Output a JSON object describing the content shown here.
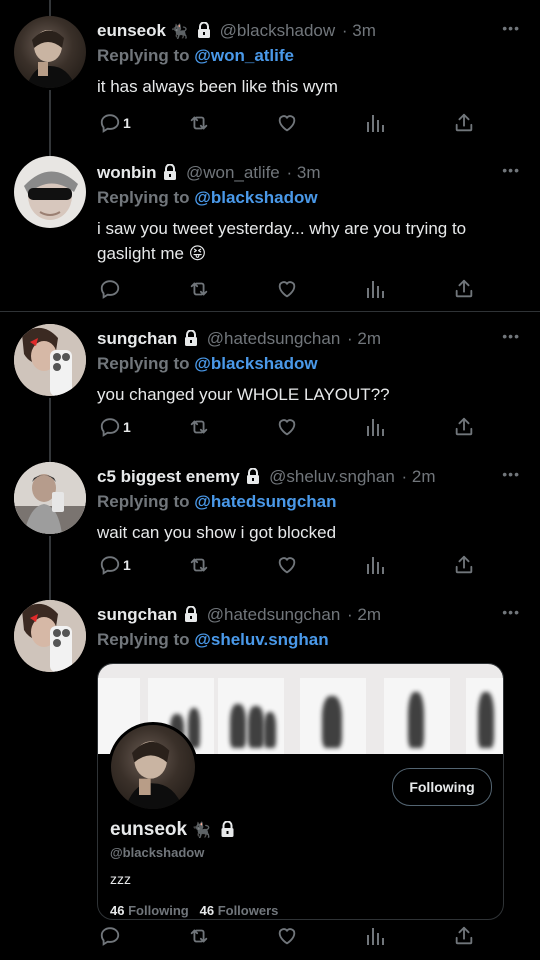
{
  "tweets": [
    {
      "name": "eunseok",
      "emoji": "🐈‍⬛",
      "handle": "@blackshadow",
      "time": "· 3m",
      "reply_prefix": "Replying to",
      "reply_to": "@won_atlife",
      "text": "it has always been like this wym",
      "reply_count": "1"
    },
    {
      "name": "wonbin",
      "emoji": "",
      "handle": "@won_atlife",
      "time": "· 3m",
      "reply_prefix": "Replying to",
      "reply_to": "@blackshadow",
      "text": "i saw you tweet yesterday... why are you trying to gaslight me 😝",
      "reply_count": ""
    },
    {
      "name": "sungchan",
      "emoji": "",
      "handle": "@hatedsungchan",
      "time": "· 2m",
      "reply_prefix": "Replying to",
      "reply_to": "@blackshadow",
      "text": "you changed your WHOLE LAYOUT??",
      "reply_count": "1"
    },
    {
      "name": "c5 biggest enemy",
      "emoji": "",
      "handle": "@sheluv.snghan",
      "time": "· 2m",
      "reply_prefix": "Replying to",
      "reply_to": "@hatedsungchan",
      "text": "wait can you show i got blocked",
      "reply_count": "1"
    },
    {
      "name": "sungchan",
      "emoji": "",
      "handle": "@hatedsungchan",
      "time": "· 2m",
      "reply_prefix": "Replying to",
      "reply_to": "@sheluv.snghan",
      "text": "",
      "reply_count": ""
    }
  ],
  "more_glyph": "•••",
  "profile_card": {
    "name": "eunseok",
    "emoji": "🐈‍⬛",
    "handle": "@blackshadow",
    "bio": "zzz",
    "following_count": "46",
    "following_label": "Following",
    "followers_count": "46",
    "followers_label": "Followers",
    "button_label": "Following"
  },
  "colors": {
    "background": "#000000",
    "text": "#e7e9ea",
    "muted": "#71767b",
    "mention": "#4a99e9",
    "divider": "#2f3336"
  },
  "icons": [
    "reply-icon",
    "retweet-icon",
    "like-icon",
    "views-icon",
    "share-icon",
    "lock-icon",
    "more-icon"
  ]
}
